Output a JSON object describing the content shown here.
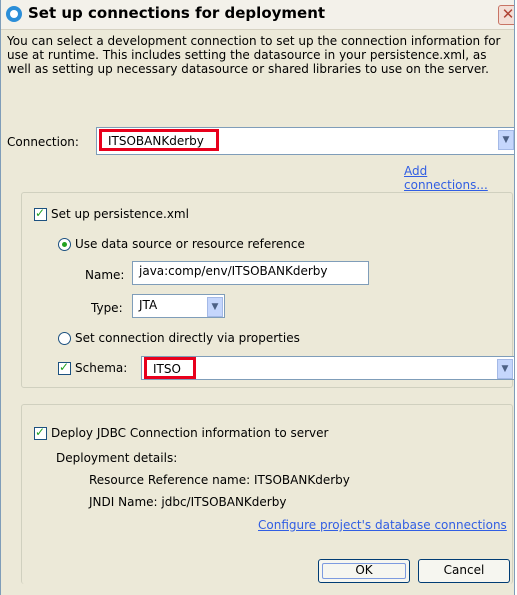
{
  "window": {
    "title": "Set up connections for deployment",
    "close_glyph": "✕",
    "app_icon": "app-icon"
  },
  "description": "You can select a development connection to set up the connection information for use at runtime.  This includes setting the datasource in your persistence.xml, as well as setting up necessary datasource or shared libraries to use on the server.",
  "connection": {
    "label": "Connection:",
    "value": "ITSOBANKderby",
    "add_link": "Add connections..."
  },
  "persistence": {
    "checkbox_label": "Set up persistence.xml",
    "checked": true,
    "use_datasource_label": "Use data source or resource reference",
    "use_datasource_selected": true,
    "name_label": "Name:",
    "name_value": "java:comp/env/ITSOBANKderby",
    "type_label": "Type:",
    "type_value": "JTA",
    "set_directly_label": "Set connection directly via properties",
    "set_directly_selected": false,
    "schema_label": "Schema:",
    "schema_checked": true,
    "schema_value": "ITSO"
  },
  "deploy": {
    "checkbox_label": "Deploy JDBC Connection information to server",
    "checked": true,
    "details_label": "Deployment details:",
    "resource_ref": "Resource Reference name: ITSOBANKderby",
    "jndi": "JNDI Name: jdbc/ITSOBANKderby",
    "configure_link": "Configure project's database connections"
  },
  "buttons": {
    "ok": "OK",
    "cancel": "Cancel"
  },
  "colors": {
    "highlight": "#e8001c",
    "link": "#315ee3",
    "dialog_bg": "#ece9d8"
  }
}
